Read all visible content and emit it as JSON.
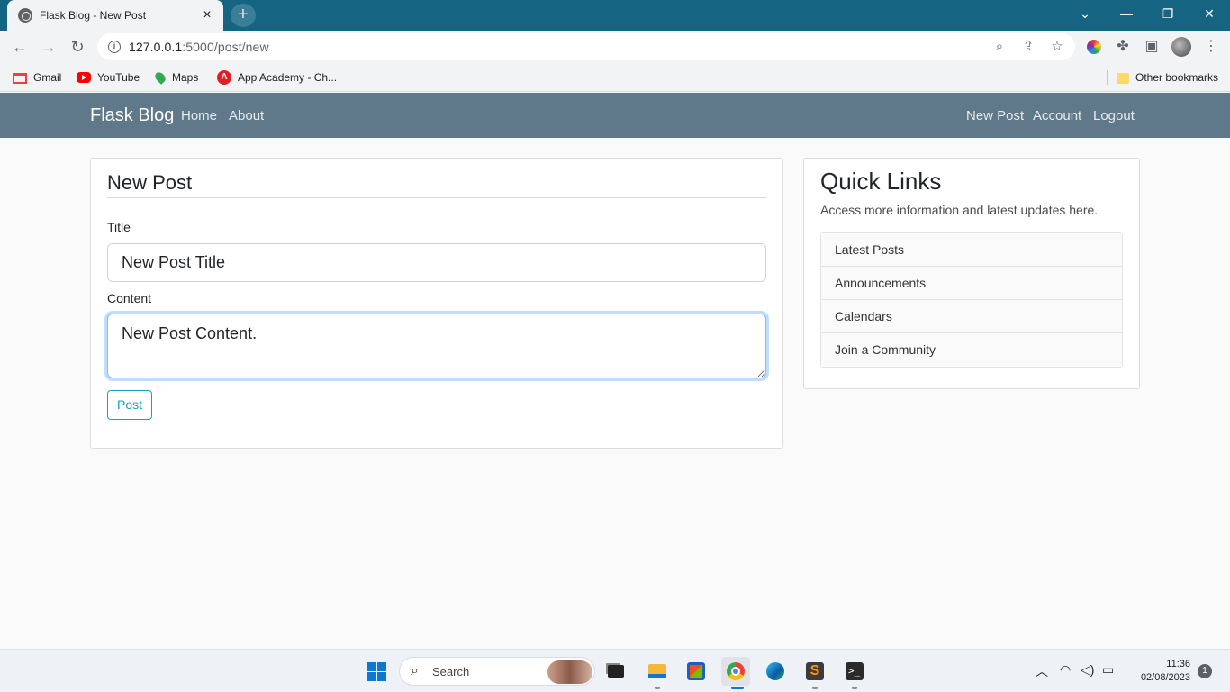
{
  "browser": {
    "tab_title": "Flask Blog - New Post",
    "url_host": "127.0.0.1",
    "url_path": ":5000/post/new",
    "bookmarks": [
      "Gmail",
      "YouTube",
      "Maps",
      "App Academy - Ch..."
    ],
    "other_bookmarks": "Other bookmarks"
  },
  "navbar": {
    "brand": "Flask Blog",
    "left_links": [
      "Home",
      "About"
    ],
    "right_links": [
      "New Post",
      "Account",
      "Logout"
    ]
  },
  "form": {
    "legend": "New Post",
    "title_label": "Title",
    "title_value": "New Post Title",
    "content_label": "Content",
    "content_value": "New Post Content.",
    "submit_label": "Post"
  },
  "sidebar": {
    "title": "Quick Links",
    "subtitle": "Access more information and latest updates here.",
    "items": [
      "Latest Posts",
      "Announcements",
      "Calendars",
      "Join a Community"
    ]
  },
  "taskbar": {
    "search_label": "Search",
    "time": "11:36",
    "date": "02/08/2023",
    "notification_count": "1"
  },
  "colors": {
    "tabbar": "#146482",
    "navbar": "#5f788a",
    "info_button": "#17a2b8",
    "focus_border": "#80bdff"
  }
}
